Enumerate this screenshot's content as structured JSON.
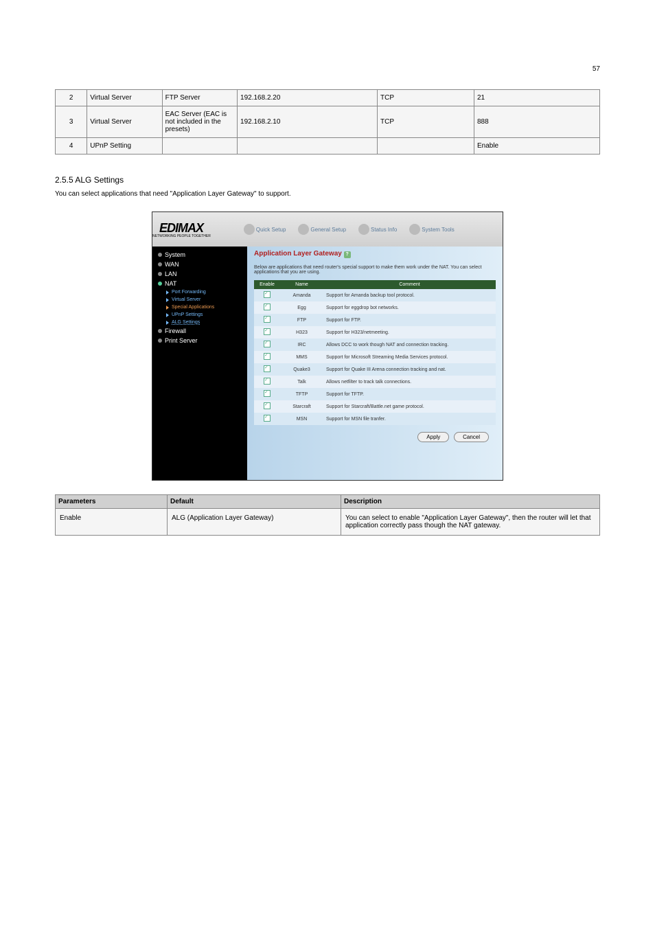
{
  "page_number": "57",
  "upper_rows": [
    {
      "num": "2",
      "c2": "Virtual Server",
      "c3": "FTP Server",
      "c4": "192.168.2.20",
      "c5": "TCP",
      "c6": "21"
    },
    {
      "num": "3",
      "c2": "Virtual Server",
      "c3": "EAC Server (EAC is not included in the presets)",
      "c4": "192.168.2.10",
      "c5": "TCP",
      "c6": "888"
    },
    {
      "num": "4",
      "c2": "UPnP Setting",
      "c3": "",
      "c4": "",
      "c5": "",
      "c6": "Enable"
    }
  ],
  "section_heading": "2.5.5   ALG Settings",
  "section_text": "You can select applications that need \"Application Layer Gateway\" to support.",
  "screenshot_topbar": {
    "logo": "EDIMAX",
    "logo_sub": "NETWORKING PEOPLE TOGETHER",
    "tabs": [
      "Quick Setup",
      "General Setup",
      "Status Info",
      "System Tools"
    ]
  },
  "sidebar": {
    "items": [
      {
        "label": "System",
        "type": "main"
      },
      {
        "label": "WAN",
        "type": "main"
      },
      {
        "label": "LAN",
        "type": "main"
      },
      {
        "label": "NAT",
        "type": "active"
      },
      {
        "label": "Port Forwarding",
        "type": "sub"
      },
      {
        "label": "Virtual Server",
        "type": "sub"
      },
      {
        "label": "Special Applications",
        "type": "sub-orange"
      },
      {
        "label": "UPnP Settings",
        "type": "sub"
      },
      {
        "label": "ALG Settings",
        "type": "sub-active"
      },
      {
        "label": "Firewall",
        "type": "main"
      },
      {
        "label": "Print Server",
        "type": "main"
      }
    ]
  },
  "ss_heading": "Application Layer Gateway",
  "ss_desc": "Below are applications that need router's special support to make them work under the NAT. You can select applications that you are using.",
  "ss_th": {
    "enable": "Enable",
    "name": "Name",
    "comment": "Comment"
  },
  "ss_rows": [
    {
      "name": "Amanda",
      "comment": "Support for Amanda backup tool protocol."
    },
    {
      "name": "Egg",
      "comment": "Support for eggdrop bot networks."
    },
    {
      "name": "FTP",
      "comment": "Support for FTP."
    },
    {
      "name": "H323",
      "comment": "Support for H323/netmeeting."
    },
    {
      "name": "IRC",
      "comment": "Allows DCC to work though NAT and connection tracking."
    },
    {
      "name": "MMS",
      "comment": "Support for Microsoft Streaming Media Services protocol."
    },
    {
      "name": "Quake3",
      "comment": "Support for Quake III Arena connection tracking and nat."
    },
    {
      "name": "Talk",
      "comment": "Allows netfilter to track talk connections."
    },
    {
      "name": "TFTP",
      "comment": "Support for TFTP."
    },
    {
      "name": "Starcraft",
      "comment": "Support for Starcraft/Battle.net game protocol."
    },
    {
      "name": "MSN",
      "comment": "Support for MSN file tranfer."
    }
  ],
  "ss_buttons": {
    "apply": "Apply",
    "cancel": "Cancel"
  },
  "lower_header": {
    "c1": "Parameters",
    "c2": "Default",
    "c3": "Description"
  },
  "lower_row": {
    "c1": "Enable",
    "c2": "ALG (Application Layer Gateway)",
    "c3": "You can select to enable \"Application Layer Gateway\", then the router will let that application correctly pass though the NAT gateway."
  }
}
